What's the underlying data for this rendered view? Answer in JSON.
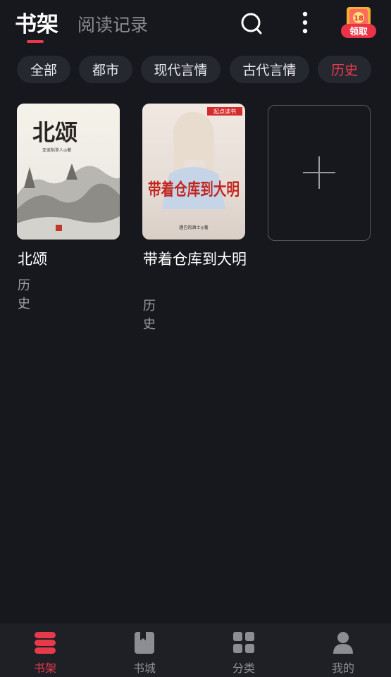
{
  "header": {
    "tab_bookshelf": "书架",
    "tab_history": "阅读记录",
    "reward_label": "领取",
    "reward_badge": "18"
  },
  "filters": [
    {
      "label": "全部",
      "active": false
    },
    {
      "label": "都市",
      "active": false
    },
    {
      "label": "现代言情",
      "active": false
    },
    {
      "label": "古代言情",
      "active": false
    },
    {
      "label": "历史",
      "active": true
    }
  ],
  "books": [
    {
      "title": "北颂",
      "genre": "历史",
      "cover_title": "北颂",
      "cover_author": "圣诞稻草人◎著"
    },
    {
      "title": "带着仓库到大明",
      "genre": "历史",
      "cover_title": "带着仓库到大明",
      "cover_author": "趣巴肉酒士◎著",
      "cover_badge": "起点读书"
    }
  ],
  "bottom_nav": [
    {
      "label": "书架",
      "active": true
    },
    {
      "label": "书城",
      "active": false
    },
    {
      "label": "分类",
      "active": false
    },
    {
      "label": "我的",
      "active": false
    }
  ],
  "colors": {
    "accent": "#e63a4b",
    "background": "#17181d",
    "chip_bg": "#262830",
    "nav_bg": "#1f2026"
  }
}
